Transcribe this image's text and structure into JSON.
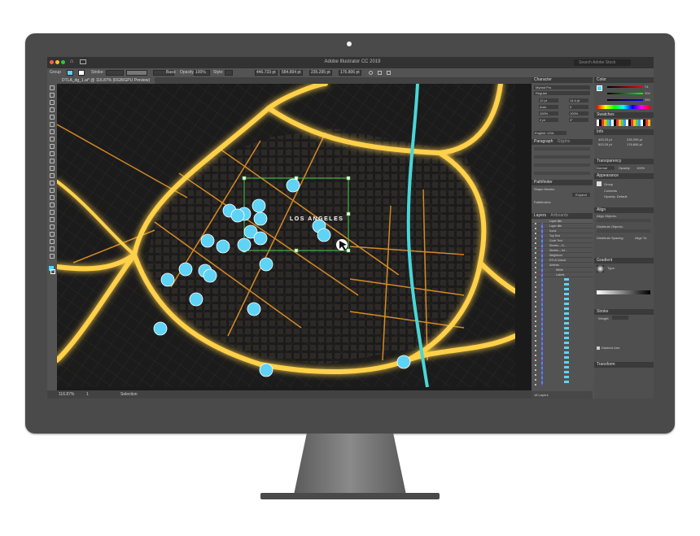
{
  "app": {
    "title": "Adobe Illustrator CC 2019",
    "search_placeholder": "Search Adobe Stock"
  },
  "control_bar": {
    "selection_label": "Group",
    "stroke_label": "Stroke:",
    "style_label": "Basic",
    "opacity_label": "Opacity:",
    "opacity_value": "100%",
    "style2_label": "Style:",
    "x_value": "446.733 pt",
    "y_value": "584.894 pt",
    "w_value": "235.295 pt",
    "h_value": "176.806 pt"
  },
  "document": {
    "tab_label": "DTLA_dg_1.ai* @ 116.87% (RGB/GPU Preview)",
    "zoom": "116.87%",
    "artboard": "1",
    "status": "Selection"
  },
  "map": {
    "city_label": "LOS ANGELES",
    "colors": {
      "highway": "#ffd04a",
      "highway_glow": "#ff9a1f",
      "street": "#f39c26",
      "river": "#4ad6d8",
      "pin": "#5fd3f5",
      "selection": "#4cc94c",
      "background": "#1b1b1b"
    }
  },
  "panels": {
    "character": {
      "title": "Character",
      "font": "Myriad Pro",
      "style": "Regular",
      "size": "12 pt",
      "leading": "14.4 pt",
      "tracking": "Auto",
      "kerning": "0",
      "scale_h": "100%",
      "scale_v": "100%",
      "baseline": "0 pt",
      "rotation": "0°",
      "language": "English: USA"
    },
    "paragraph": {
      "tab1": "Paragraph",
      "tab2": "Glyphs"
    },
    "pathfinder": {
      "title": "Pathfinder",
      "shape_modes": "Shape Modes:",
      "expand": "Expand",
      "pathfinders": "Pathfinders:"
    },
    "layers": {
      "tab1": "Layers",
      "tab2": "Artboards",
      "rows": [
        "Layer title",
        "Layer title",
        "Icons",
        "Top Text",
        "Code Text",
        "Streets – H...",
        "Streets – Int...",
        "Neighbors",
        "DTLA Cutout",
        "Arteries",
        "White",
        "Labels"
      ],
      "footer": "18 Layers"
    },
    "color": {
      "title": "Color",
      "r": "74",
      "g": "204",
      "b": "250"
    },
    "swatches": {
      "title": "Swatches"
    },
    "info": {
      "title": "Info",
      "x": "403.23 pt",
      "y": "503.29 pt",
      "w": "235.295 pt",
      "h": "176.806 pt"
    },
    "transparency": {
      "title": "Transparency",
      "mode": "Normal",
      "opacity_label": "Opacity:",
      "opacity": "100%"
    },
    "appearance": {
      "title": "Appearance",
      "group": "Group",
      "contents": "Contents",
      "opacity": "Opacity: Default"
    },
    "align": {
      "title": "Align",
      "objects": "Align Objects:",
      "distribute": "Distribute Objects:",
      "spacing": "Distribute Spacing:",
      "align_to": "Align To:"
    },
    "gradient": {
      "title": "Gradient",
      "type_label": "Type:"
    },
    "stroke": {
      "title": "Stroke",
      "weight_label": "Weight:",
      "dashed": "Dashed Line"
    },
    "transform": {
      "title": "Transform"
    }
  }
}
